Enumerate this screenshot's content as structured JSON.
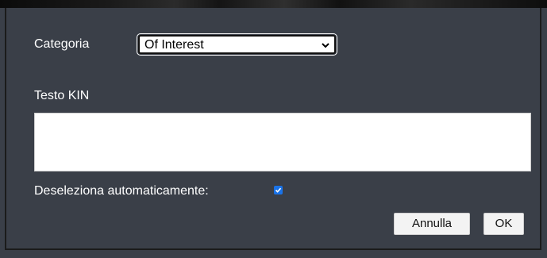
{
  "form": {
    "category_label": "Categoria",
    "category_value": "Of Interest",
    "kin_label": "Testo KIN",
    "kin_value": "",
    "deselect_label": "Deseleziona automaticamente:",
    "deselect_checked": true
  },
  "buttons": {
    "cancel_label": "Annulla",
    "ok_label": "OK"
  },
  "icons": {
    "select_arrow": "chevron-down-icon",
    "checkbox_mark": "check-icon"
  },
  "colors": {
    "dialog_bg": "#3a3f48",
    "checkbox_accent": "#1a73e8"
  }
}
